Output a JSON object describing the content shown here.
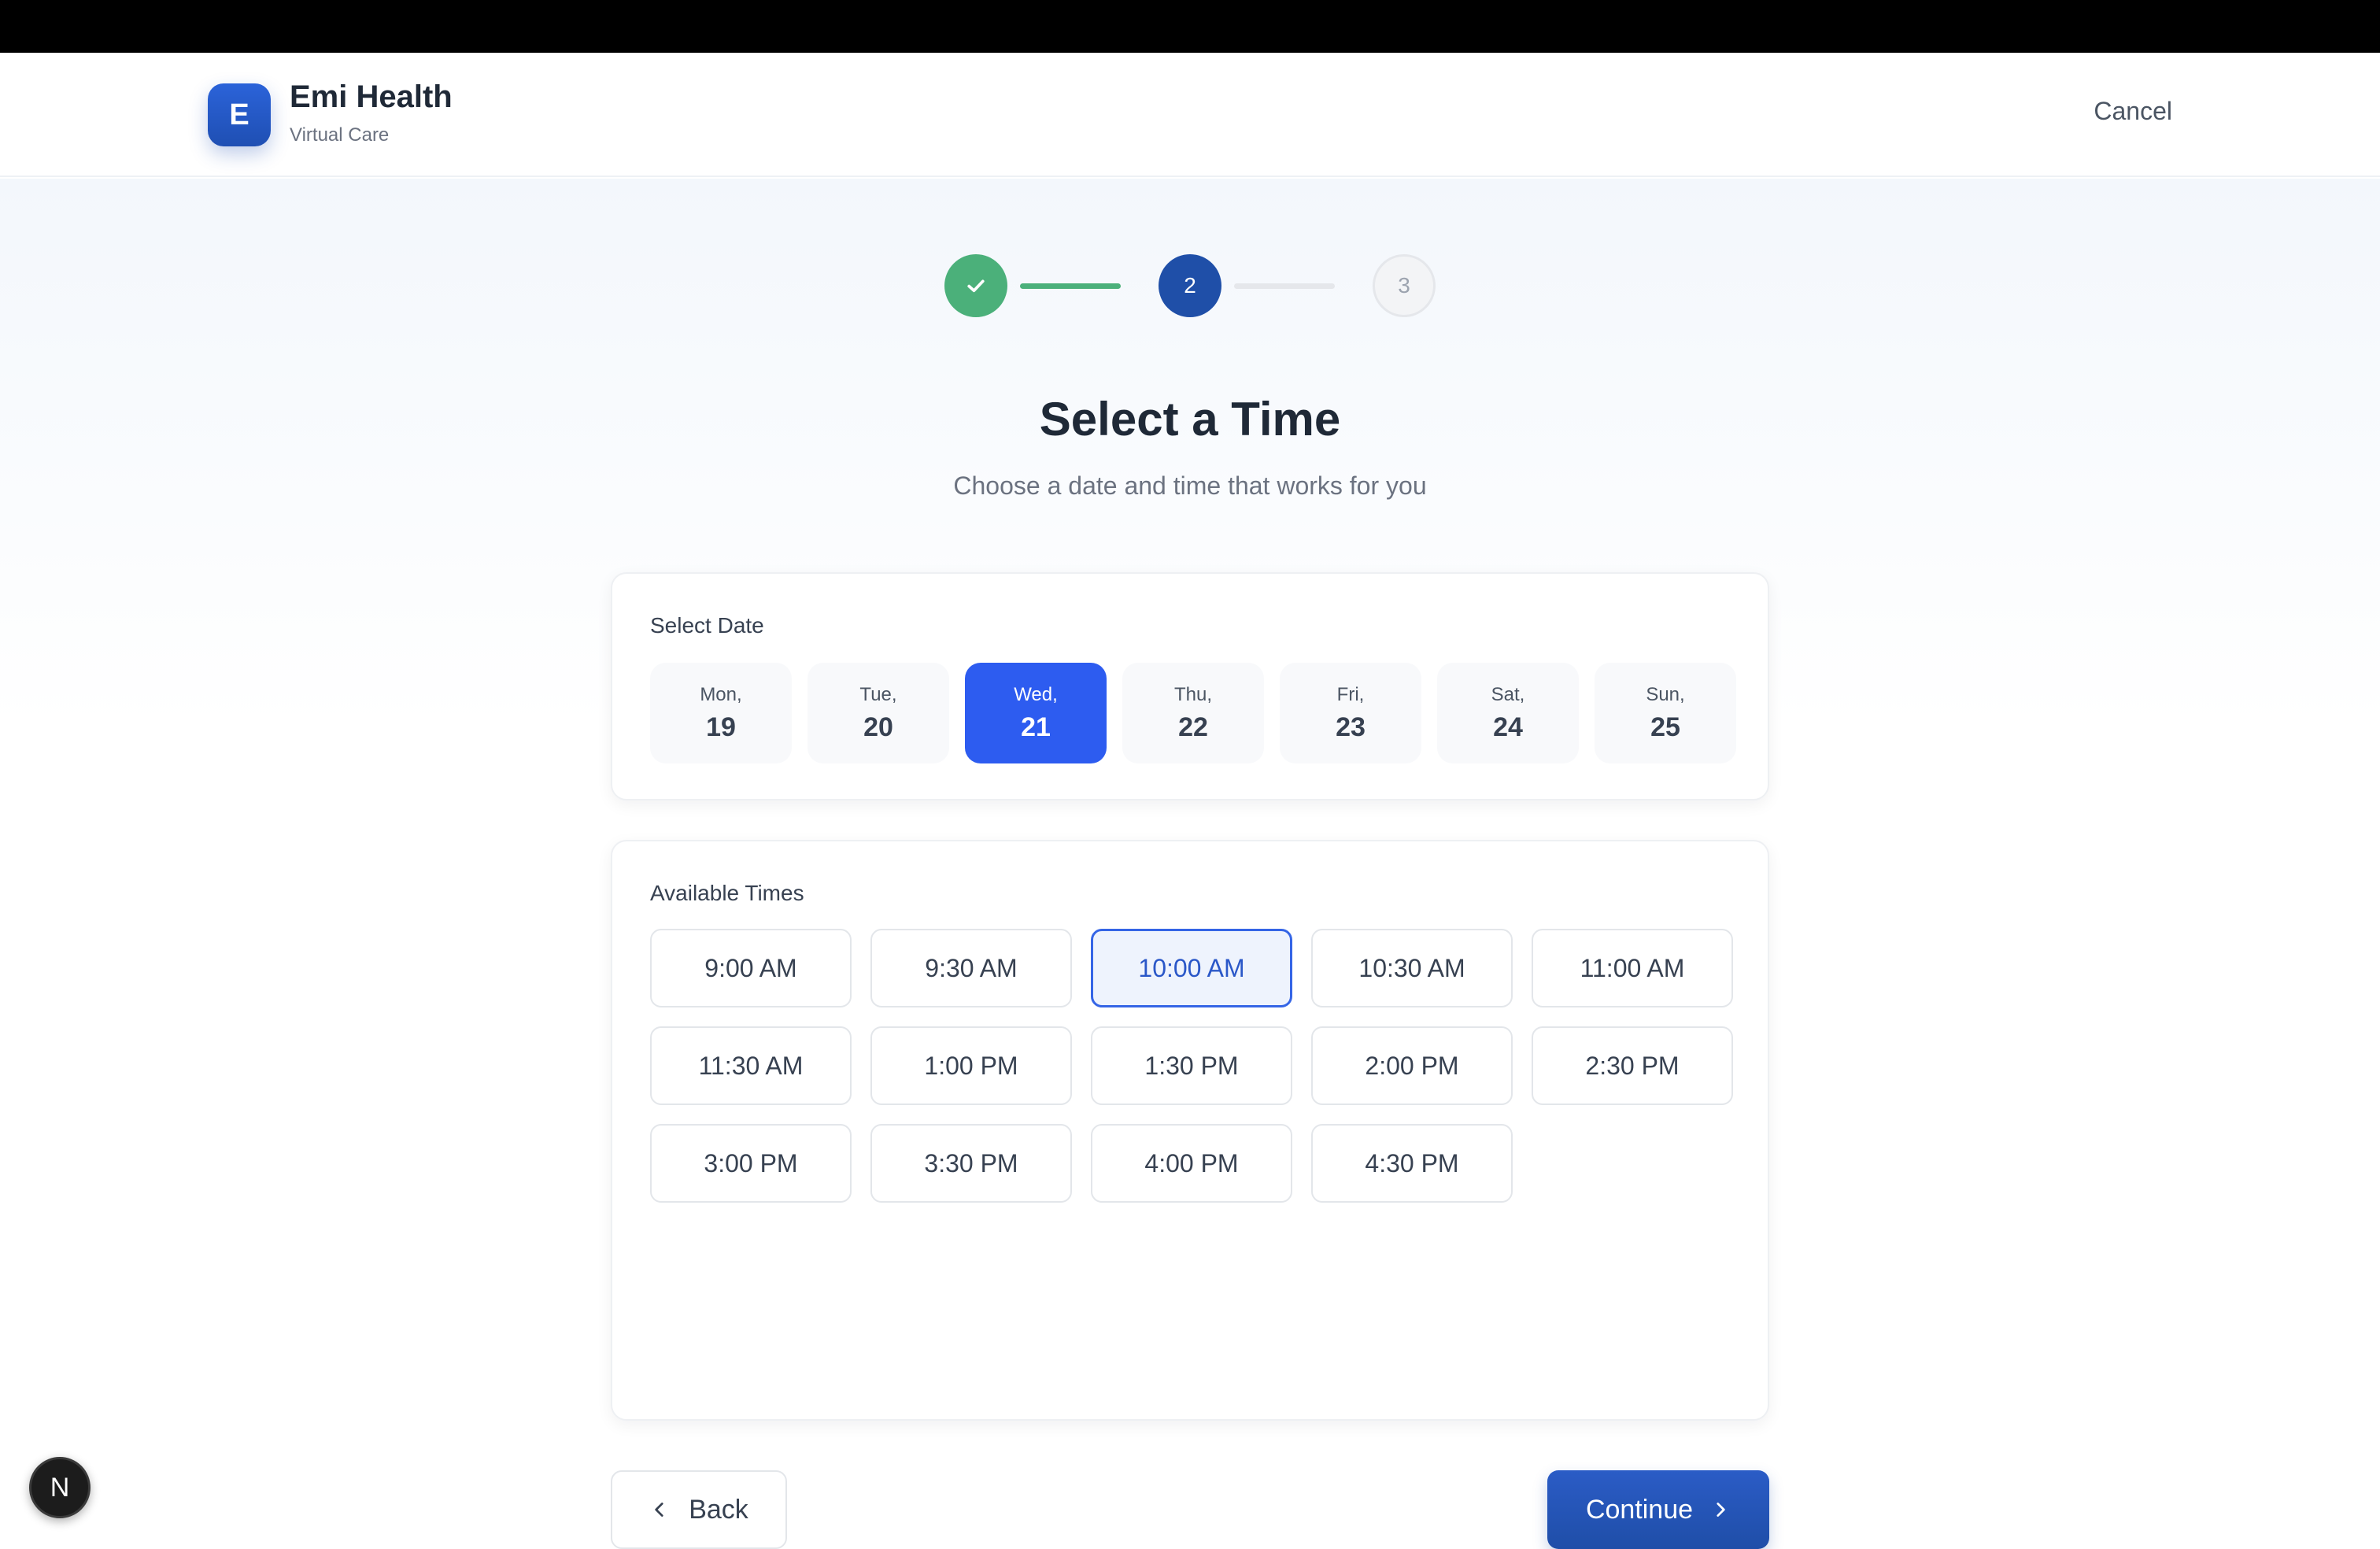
{
  "header": {
    "logo_letter": "E",
    "brand_name": "Emi Health",
    "brand_sub": "Virtual Care",
    "cancel_label": "Cancel"
  },
  "stepper": {
    "current_step": 2,
    "steps": [
      {
        "label": "",
        "state": "completed",
        "icon": "check-icon"
      },
      {
        "label": "2",
        "state": "active"
      },
      {
        "label": "3",
        "state": "upcoming"
      }
    ],
    "colors": {
      "completed": "#4bb07a",
      "active": "#1f4fa8",
      "upcoming": "#f3f4f6"
    }
  },
  "page": {
    "title": "Select a Time",
    "subtitle": "Choose a date and time that works for you"
  },
  "date_section": {
    "label": "Select Date",
    "selected_index": 2,
    "dates": [
      {
        "dow": "Mon,",
        "day": "19"
      },
      {
        "dow": "Tue,",
        "day": "20"
      },
      {
        "dow": "Wed,",
        "day": "21"
      },
      {
        "dow": "Thu,",
        "day": "22"
      },
      {
        "dow": "Fri,",
        "day": "23"
      },
      {
        "dow": "Sat,",
        "day": "24"
      },
      {
        "dow": "Sun,",
        "day": "25"
      }
    ]
  },
  "time_section": {
    "label": "Available Times",
    "selected_index": 2,
    "times": [
      "9:00 AM",
      "9:30 AM",
      "10:00 AM",
      "10:30 AM",
      "11:00 AM",
      "11:30 AM",
      "1:00 PM",
      "1:30 PM",
      "2:00 PM",
      "2:30 PM",
      "3:00 PM",
      "3:30 PM",
      "4:00 PM",
      "4:30 PM"
    ]
  },
  "actions": {
    "back_label": "Back",
    "continue_label": "Continue"
  },
  "dev_badge": {
    "letter": "N"
  },
  "colors": {
    "accent": "#2d5cf0",
    "brand": "#1f4fa8",
    "success": "#4bb07a"
  }
}
